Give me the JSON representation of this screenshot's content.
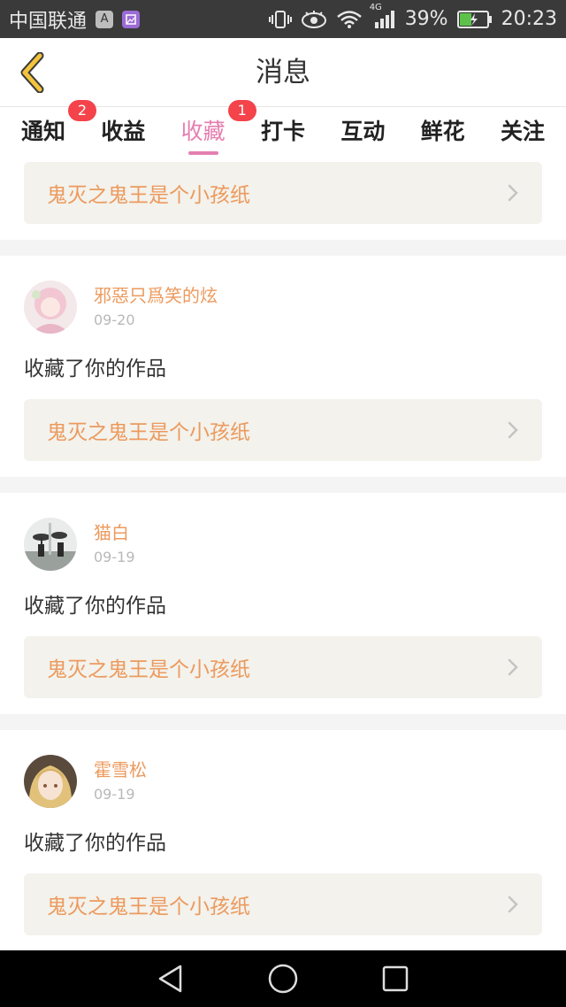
{
  "status_bar": {
    "carrier": "中国联通",
    "badge_a": "A",
    "battery": "39%",
    "network": "4G",
    "time": "20:23"
  },
  "header": {
    "title": "消息",
    "back_icon": "back-chevron-icon"
  },
  "tabs": [
    {
      "label": "通知",
      "badge": "2"
    },
    {
      "label": "收益",
      "badge": ""
    },
    {
      "label": "收藏",
      "badge": "1",
      "active": true
    },
    {
      "label": "打卡",
      "badge": ""
    },
    {
      "label": "互动",
      "badge": ""
    },
    {
      "label": "鲜花",
      "badge": ""
    },
    {
      "label": "关注",
      "badge": ""
    }
  ],
  "feed": {
    "partial_item": {
      "work_title": "鬼灭之鬼王是个小孩纸"
    },
    "items": [
      {
        "username": "邪惡只爲笑的炫",
        "date": "09-20",
        "action": "收藏了你的作品",
        "work_title": "鬼灭之鬼王是个小孩纸"
      },
      {
        "username": "猫白",
        "date": "09-19",
        "action": "收藏了你的作品",
        "work_title": "鬼灭之鬼王是个小孩纸"
      },
      {
        "username": "霍雪松",
        "date": "09-19",
        "action": "收藏了你的作品",
        "work_title": "鬼灭之鬼王是个小孩纸"
      }
    ]
  },
  "colors": {
    "accent_pink": "#e47fb0",
    "username_orange": "#ec9a5e",
    "badge_red": "#f4434a",
    "link_bg": "#f3f2ec"
  }
}
